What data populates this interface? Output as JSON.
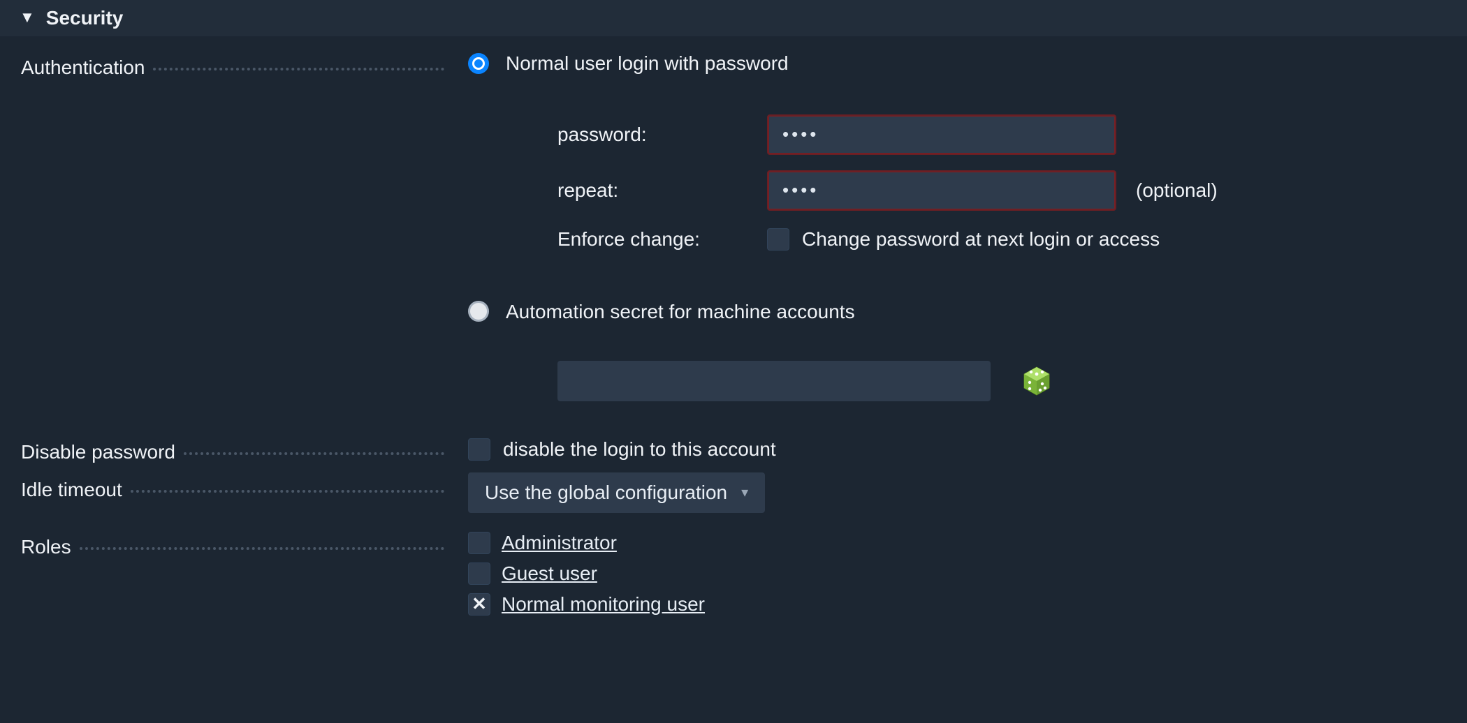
{
  "section": {
    "title": "Security"
  },
  "labels": {
    "authentication": "Authentication",
    "disable_password": "Disable password",
    "idle_timeout": "Idle timeout",
    "roles": "Roles"
  },
  "auth": {
    "normal_login": "Normal user login with password",
    "password_label": "password:",
    "repeat_label": "repeat:",
    "password_value": "••••",
    "repeat_value": "••••",
    "optional": "(optional)",
    "enforce_change_label": "Enforce change:",
    "enforce_change_text": "Change password at next login or access",
    "automation_secret": "Automation secret for machine accounts",
    "secret_value": ""
  },
  "disable_password_text": "disable the login to this account",
  "idle_timeout_value": "Use the global configuration",
  "roles": [
    {
      "label": "Administrator",
      "checked": false
    },
    {
      "label": "Guest user",
      "checked": false
    },
    {
      "label": "Normal monitoring user",
      "checked": true
    }
  ]
}
